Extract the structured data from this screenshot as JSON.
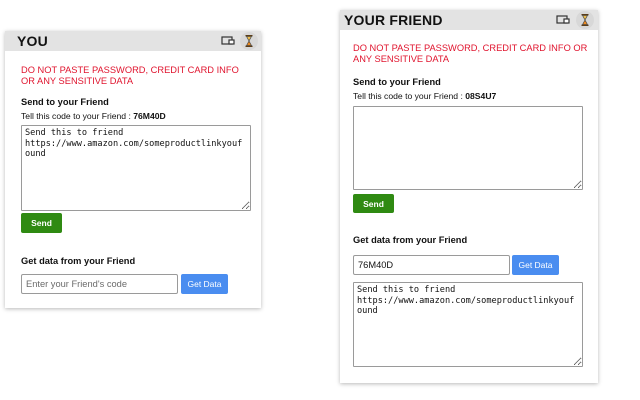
{
  "you": {
    "title": "YOU",
    "warning": "DO NOT PASTE PASSWORD, CREDIT CARD INFO OR ANY SENSITIVE DATA",
    "send_heading": "Send to your Friend",
    "code_label": "Tell this code to your Friend : ",
    "code": "76M40D",
    "message": "Send this to friend\nhttps://www.amazon.com/someproductlinkyoufound",
    "send_label": "Send",
    "get_heading": "Get data from your Friend",
    "code_input_value": "",
    "code_input_placeholder": "Enter your Friend's code",
    "get_label": "Get Data"
  },
  "friend": {
    "title": "YOUR FRIEND",
    "warning": "DO NOT PASTE PASSWORD, CREDIT CARD INFO OR ANY SENSITIVE DATA",
    "send_heading": "Send to your Friend",
    "code_label": "Tell this code to your Friend : ",
    "code": "08S4U7",
    "message": "",
    "send_label": "Send",
    "get_heading": "Get data from your Friend",
    "code_input_value": "76M40D",
    "code_input_placeholder": "",
    "get_label": "Get Data",
    "received": "Send this to friend\nhttps://www.amazon.com/someproductlinkyoufound"
  },
  "icons": {
    "screen": "screen-share-icon",
    "hourglass": "hourglass-icon"
  },
  "colors": {
    "warning": "#e0142e",
    "send_button": "#2f8a12",
    "get_button": "#4a8df0",
    "header": "#e3e3e3"
  }
}
